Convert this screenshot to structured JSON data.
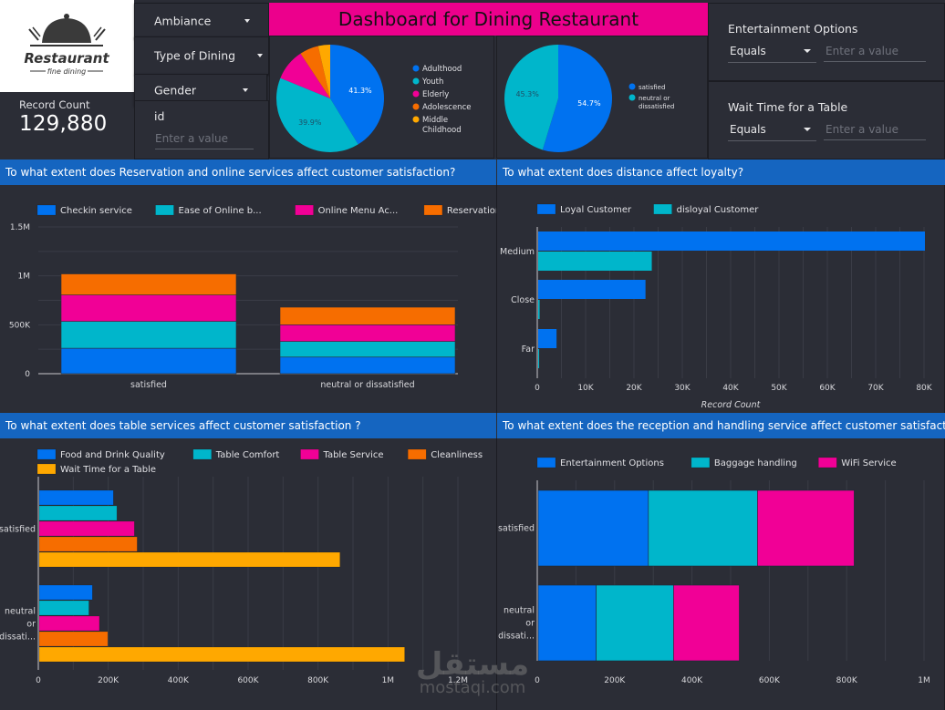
{
  "logo": {
    "brand": "Restaurant",
    "tagline": "fine dining"
  },
  "scorecard": {
    "label": "Record Count",
    "value": "129,880"
  },
  "filters": {
    "ambiance": "Ambiance",
    "type_of_dining": "Type of Dining",
    "gender": "Gender",
    "id": {
      "label": "id",
      "placeholder": "Enter a value"
    },
    "entertainment": {
      "label": "Entertainment Options",
      "operator": "Equals",
      "placeholder": "Enter a value"
    },
    "wait_time": {
      "label": "Wait Time for a Table",
      "operator": "Equals",
      "placeholder": "Enter a value"
    }
  },
  "header": {
    "title": "Dashboard for Dining Restaurant"
  },
  "colors": {
    "blue": "#0072f0",
    "teal": "#00b6cb",
    "pink": "#f10096",
    "orange": "#f66d00",
    "yellow": "#ffa800",
    "title_bg": "#ec008c",
    "section_bg": "#1565c0",
    "panel_bg": "#2b2d36"
  },
  "sections": {
    "reservation": "To what extent does  Reservation and online services  affect customer satisfaction?",
    "distance": "To what extent does distance affect loyalty?",
    "table": "To what extent does table services affect customer satisfaction ?",
    "reception": "To what extent does the reception and handling service affect customer satisfaction ??"
  },
  "watermark": {
    "arabic": "مستقل",
    "latin": "mostaqi.com"
  },
  "chart_data": [
    {
      "id": "age_pie",
      "type": "pie",
      "title": "",
      "labels": [
        "Adulthood",
        "Youth",
        "Elderly",
        "Adolescence",
        "Middle Childhood"
      ],
      "values": [
        41.3,
        39.9,
        9.5,
        5.7,
        3.6
      ],
      "shown_labels": [
        "41.3%",
        "39.9%",
        "",
        "",
        ""
      ],
      "colors": [
        "#0072f0",
        "#00b6cb",
        "#f10096",
        "#f66d00",
        "#ffa800"
      ],
      "legend": "right"
    },
    {
      "id": "satisfaction_pie",
      "type": "pie",
      "title": "",
      "labels": [
        "satisfied",
        "neutral or dissatisfied"
      ],
      "values": [
        54.7,
        45.3
      ],
      "shown_labels": [
        "54.7%",
        "45.3%"
      ],
      "colors": [
        "#0072f0",
        "#00b6cb"
      ],
      "legend": "right"
    },
    {
      "id": "reservation_chart",
      "type": "bar",
      "orientation": "vertical",
      "stacked": true,
      "title": "To what extent does  Reservation and online services  affect customer satisfaction?",
      "categories": [
        "satisfied",
        "neutral or dissatisfied"
      ],
      "series": [
        {
          "name": "Checkin service",
          "legend_label": "Checkin service",
          "color": "#0072f0",
          "values": [
            260000,
            170000
          ]
        },
        {
          "name": "Ease of Online booking",
          "legend_label": "Ease of Online b...",
          "color": "#00b6cb",
          "values": [
            275000,
            160000
          ]
        },
        {
          "name": "Online Menu Access",
          "legend_label": "Online Menu Ac...",
          "color": "#f10096",
          "values": [
            270000,
            170000
          ]
        },
        {
          "name": "Reservation Convenience",
          "legend_label": "Reservation Con...",
          "color": "#f66d00",
          "values": [
            215000,
            180000
          ]
        }
      ],
      "yticks": [
        0,
        500000,
        1000000,
        1500000
      ],
      "ytick_labels": [
        "0",
        "500K",
        "1M",
        "1.5M"
      ],
      "ylim": [
        0,
        1500000
      ],
      "grid": true,
      "legend": "top",
      "xlabel": "",
      "ylabel": ""
    },
    {
      "id": "distance_chart",
      "type": "bar",
      "orientation": "horizontal",
      "stacked": false,
      "title": "To what extent does distance affect loyalty?",
      "categories": [
        "Medium",
        "Close",
        "Far"
      ],
      "series": [
        {
          "name": "Loyal Customer",
          "legend_label": "Loyal Customer",
          "color": "#0072f0",
          "values": [
            80000,
            22200,
            3800
          ]
        },
        {
          "name": "disloyal Customer",
          "legend_label": "disloyal Customer",
          "color": "#00b6cb",
          "values": [
            23500,
            300,
            200
          ]
        }
      ],
      "xticks": [
        0,
        10000,
        20000,
        30000,
        40000,
        50000,
        60000,
        70000,
        80000
      ],
      "xtick_labels": [
        "0",
        "10K",
        "20K",
        "30K",
        "40K",
        "50K",
        "60K",
        "70K",
        "80K"
      ],
      "xlim": [
        0,
        80000
      ],
      "xlabel": "Record Count",
      "ylabel": "",
      "grid": true,
      "legend": "top"
    },
    {
      "id": "table_chart",
      "type": "bar",
      "orientation": "horizontal",
      "stacked": false,
      "title": "To what extent does table services affect customer satisfaction ?",
      "categories": [
        "satisfied",
        "neutral or dissatisfied"
      ],
      "category_labels": [
        [
          "satisfied"
        ],
        [
          "neutral",
          "or",
          "dissati..."
        ]
      ],
      "series": [
        {
          "name": "Food and Drink Quality",
          "legend_label": "Food and Drink Quality",
          "color": "#0072f0",
          "values": [
            212000,
            152000
          ]
        },
        {
          "name": "Table Comfort",
          "legend_label": "Table Comfort",
          "color": "#00b6cb",
          "values": [
            222000,
            142000
          ]
        },
        {
          "name": "Table Service",
          "legend_label": "Table Service",
          "color": "#f10096",
          "values": [
            272000,
            172000
          ]
        },
        {
          "name": "Cleanliness",
          "legend_label": "Cleanliness",
          "color": "#f66d00",
          "values": [
            280000,
            196000
          ]
        },
        {
          "name": "Wait Time for a Table",
          "legend_label": "Wait Time for a Table",
          "color": "#ffa800",
          "values": [
            860000,
            1045000
          ]
        }
      ],
      "xticks": [
        0,
        200000,
        400000,
        600000,
        800000,
        1000000,
        1200000
      ],
      "xtick_labels": [
        "0",
        "200K",
        "400K",
        "600K",
        "800K",
        "1M",
        "1.2M"
      ],
      "xlim": [
        0,
        1200000
      ],
      "xlabel": "",
      "ylabel": "",
      "grid": true,
      "legend": "top"
    },
    {
      "id": "reception_chart",
      "type": "bar",
      "orientation": "horizontal",
      "stacked": true,
      "title": "To what extent does the reception and handling service affect customer satisfaction ??",
      "categories": [
        "satisfied",
        "neutral or dissatisfied"
      ],
      "category_labels": [
        [
          "satisfied"
        ],
        [
          "neutral",
          "or",
          "dissati..."
        ]
      ],
      "series": [
        {
          "name": "Entertainment Options",
          "legend_label": "Entertainment Options",
          "color": "#0072f0",
          "values": [
            285000,
            150000
          ]
        },
        {
          "name": "Baggage handling",
          "legend_label": "Baggage handling",
          "color": "#00b6cb",
          "values": [
            282000,
            200000
          ]
        },
        {
          "name": "WiFi Service",
          "legend_label": "WiFi Service",
          "color": "#f10096",
          "values": [
            250000,
            170000
          ]
        }
      ],
      "xticks": [
        0,
        200000,
        400000,
        600000,
        800000,
        1000000
      ],
      "xtick_labels": [
        "0",
        "200K",
        "400K",
        "600K",
        "800K",
        "1M"
      ],
      "xlim": [
        0,
        1000000
      ],
      "xlabel": "",
      "ylabel": "",
      "grid": true,
      "legend": "top"
    }
  ]
}
